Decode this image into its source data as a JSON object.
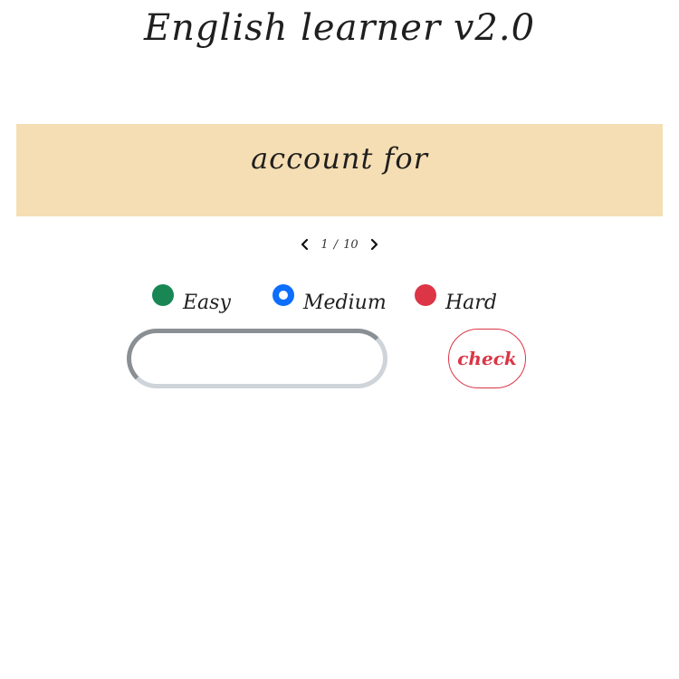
{
  "app": {
    "title": "English learner v2.0"
  },
  "card": {
    "word": "account for"
  },
  "pager": {
    "current": "1",
    "separator": "/",
    "total": "10"
  },
  "difficulty": {
    "selected": "Medium",
    "options": [
      {
        "label": "Easy",
        "color": "#198754"
      },
      {
        "label": "Medium",
        "color": "#0d6efd"
      },
      {
        "label": "Hard",
        "color": "#dc3545"
      }
    ]
  },
  "answer": {
    "value": "",
    "placeholder": ""
  },
  "actions": {
    "check_label": "check",
    "check_color": "#dc3545"
  },
  "colors": {
    "card_background": "#f5deb3"
  }
}
